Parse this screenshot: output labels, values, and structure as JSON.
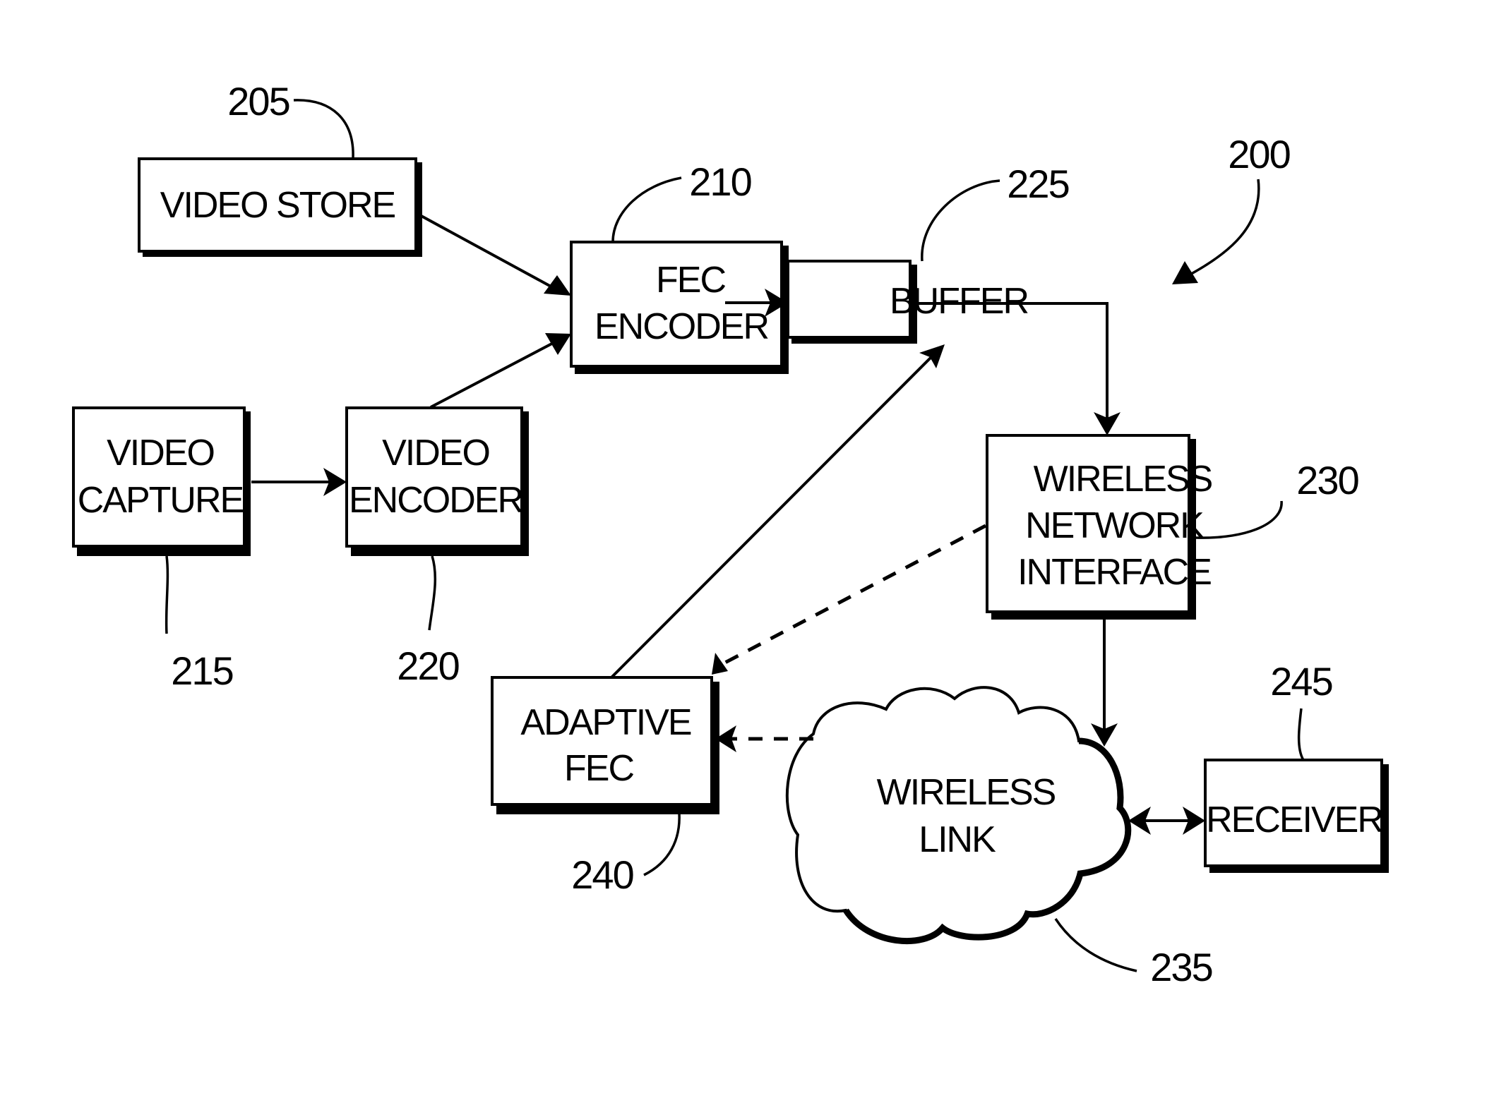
{
  "figure": {
    "ref": "200",
    "blocks": {
      "video_store": {
        "ref": "205",
        "lines": [
          "VIDEO STORE"
        ]
      },
      "fec_encoder": {
        "ref": "210",
        "lines": [
          "FEC",
          "ENCODER"
        ]
      },
      "video_capture": {
        "ref": "215",
        "lines": [
          "VIDEO",
          "CAPTURE"
        ]
      },
      "video_encoder": {
        "ref": "220",
        "lines": [
          "VIDEO",
          "ENCODER"
        ]
      },
      "buffer": {
        "ref": "225",
        "lines": [
          "BUFFER"
        ]
      },
      "wireless_network_interface": {
        "ref": "230",
        "lines": [
          "WIRELESS",
          "NETWORK",
          "INTERFACE"
        ]
      },
      "wireless_link": {
        "ref": "235",
        "lines": [
          "WIRELESS",
          "LINK"
        ]
      },
      "adaptive_fec": {
        "ref": "240",
        "lines": [
          "ADAPTIVE",
          "FEC"
        ]
      },
      "receiver": {
        "ref": "245",
        "lines": [
          "RECEIVER"
        ]
      }
    },
    "connections": [
      {
        "from": "VIDEO STORE",
        "to": "FEC ENCODER",
        "style": "solid",
        "direction": "forward"
      },
      {
        "from": "VIDEO ENCODER",
        "to": "FEC ENCODER",
        "style": "solid",
        "direction": "forward"
      },
      {
        "from": "VIDEO CAPTURE",
        "to": "VIDEO ENCODER",
        "style": "solid",
        "direction": "forward"
      },
      {
        "from": "FEC ENCODER",
        "to": "BUFFER",
        "style": "solid",
        "direction": "forward"
      },
      {
        "from": "BUFFER",
        "to": "WIRELESS NETWORK INTERFACE",
        "style": "solid",
        "direction": "forward"
      },
      {
        "from": "WIRELESS NETWORK INTERFACE",
        "to": "WIRELESS LINK",
        "style": "solid",
        "direction": "forward"
      },
      {
        "from": "WIRELESS LINK",
        "to": "RECEIVER",
        "style": "solid",
        "direction": "bidirectional"
      },
      {
        "from": "WIRELESS NETWORK INTERFACE",
        "to": "ADAPTIVE FEC",
        "style": "dashed",
        "direction": "forward"
      },
      {
        "from": "WIRELESS LINK",
        "to": "ADAPTIVE FEC",
        "style": "dashed",
        "direction": "forward"
      },
      {
        "from": "ADAPTIVE FEC",
        "to": "BUFFER",
        "style": "solid",
        "direction": "forward"
      }
    ]
  }
}
